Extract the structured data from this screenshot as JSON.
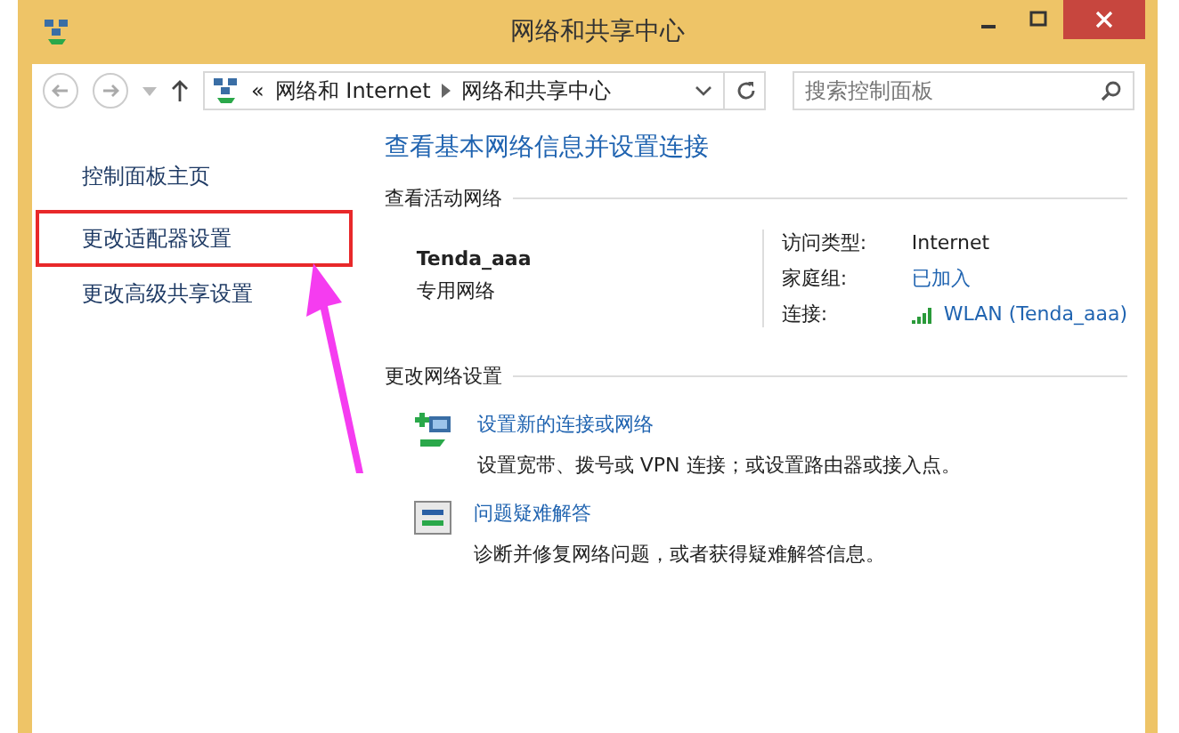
{
  "window": {
    "title": "网络和共享中心"
  },
  "nav": {
    "breadcrumb": [
      "«",
      "网络和 Internet",
      "网络和共享中心"
    ],
    "search": {
      "placeholder": "搜索控制面板"
    }
  },
  "sidebar": {
    "items": [
      {
        "label": "控制面板主页",
        "highlighted": false
      },
      {
        "label": "更改适配器设置",
        "highlighted": true
      },
      {
        "label": "更改高级共享设置",
        "highlighted": false
      }
    ]
  },
  "main": {
    "heading": "查看基本网络信息并设置连接",
    "active_section": "查看活动网络",
    "network": {
      "name": "Tenda_aaa",
      "category": "专用网络",
      "details": [
        {
          "label": "访问类型:",
          "value": "Internet",
          "kind": "text"
        },
        {
          "label": "家庭组:",
          "value": "已加入",
          "kind": "link"
        },
        {
          "label": "连接:",
          "value": "WLAN (Tenda_aaa)",
          "kind": "wifi"
        }
      ]
    },
    "change_section": "更改网络设置",
    "tasks": [
      {
        "kind": "new-connection",
        "title": "设置新的连接或网络",
        "description": "设置宽带、拨号或 VPN 连接；或设置路由器或接入点。"
      },
      {
        "kind": "troubleshoot",
        "title": "问题疑难解答",
        "description": "诊断并修复网络问题，或者获得疑难解答信息。"
      }
    ]
  }
}
